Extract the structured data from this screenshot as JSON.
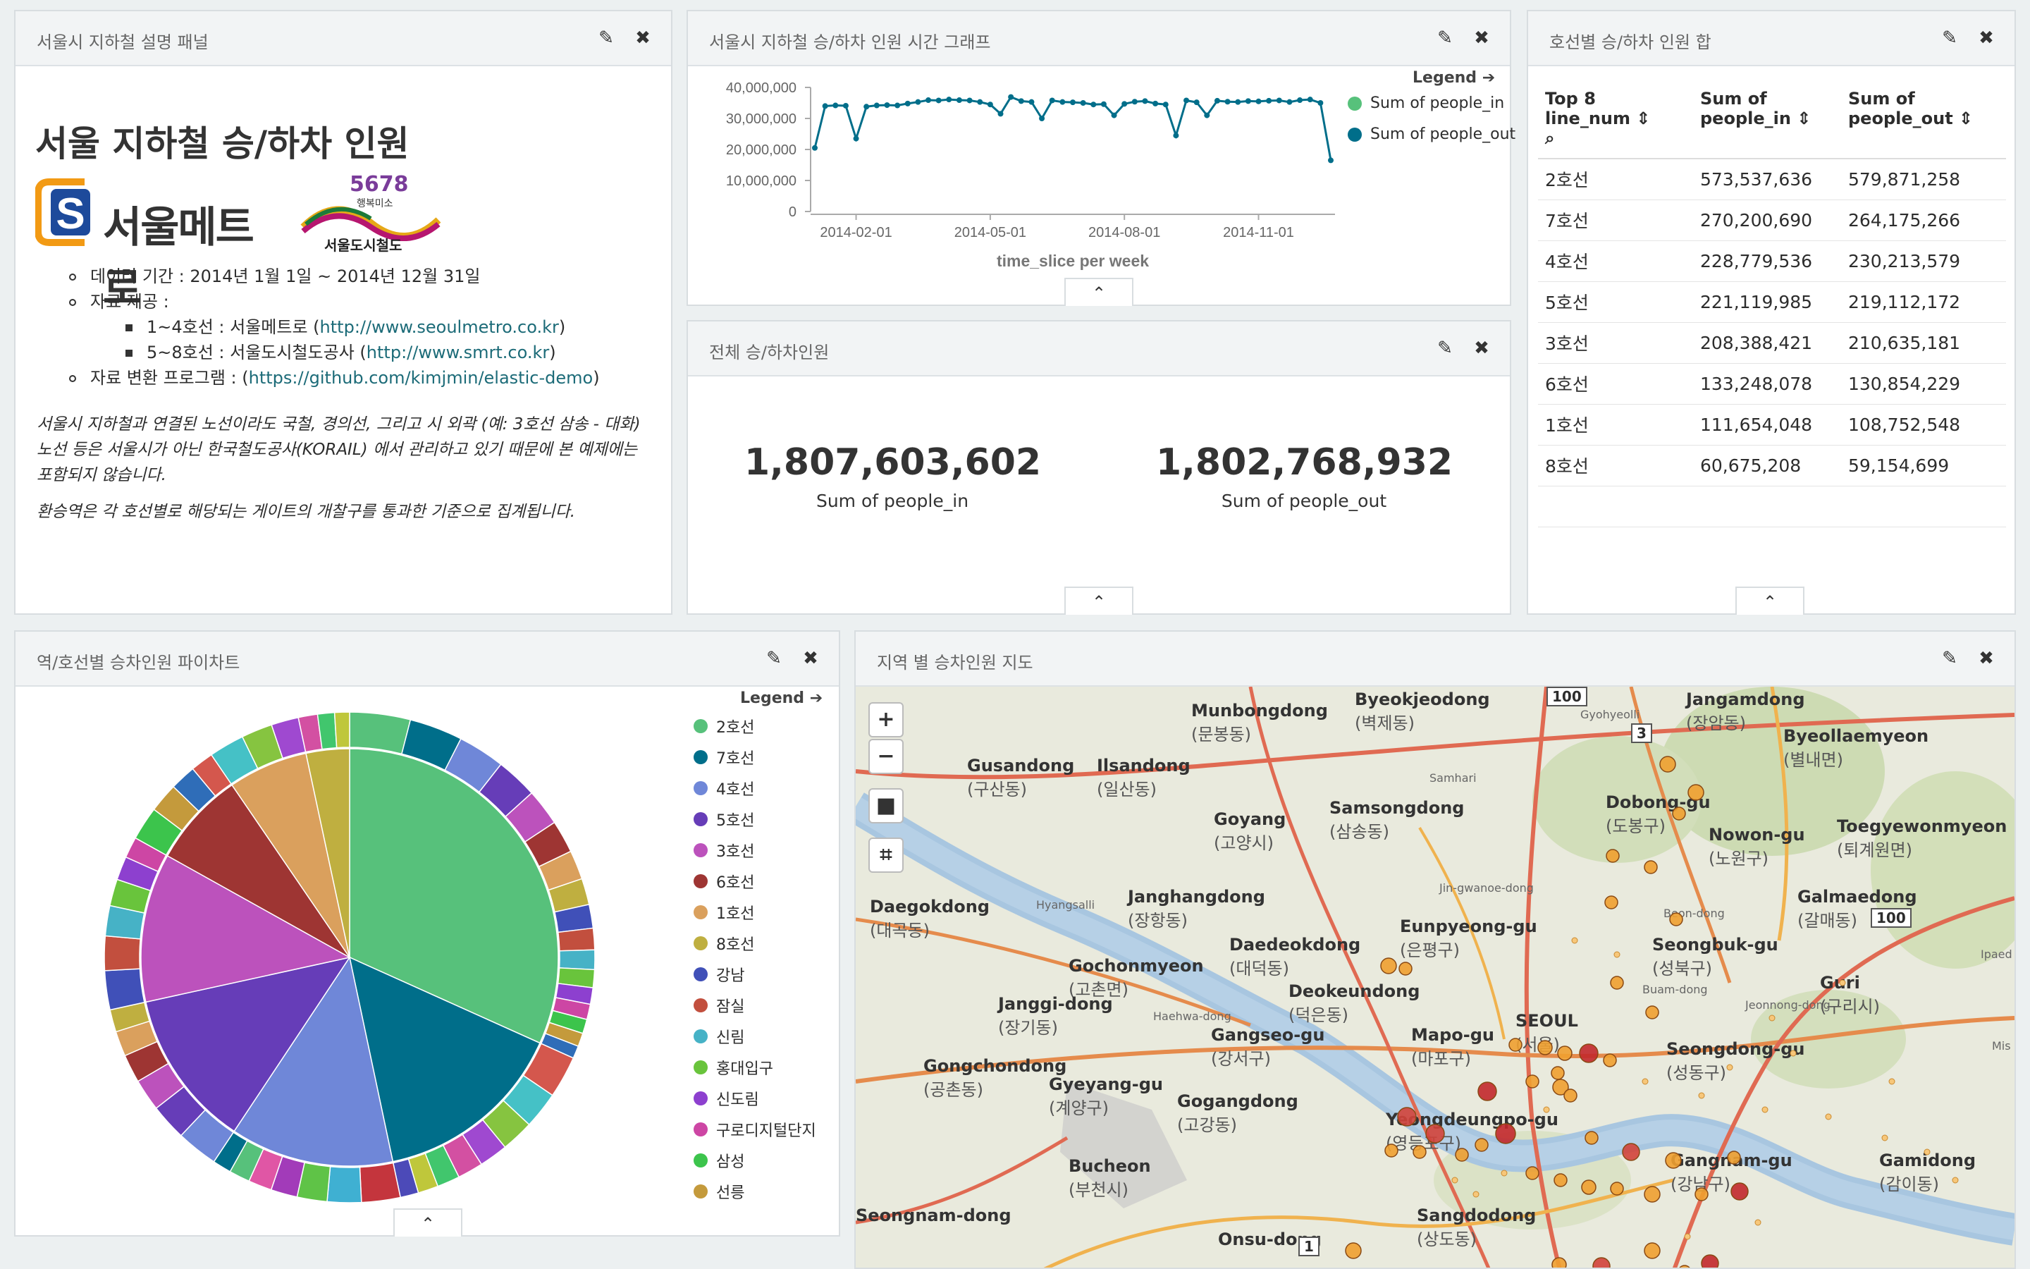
{
  "panel_desc": {
    "title": "서울시 지하철 설명 패널",
    "heading": "서울 지하철 승/하차 인원",
    "logo_metro": "서울메트로",
    "logo_smrt_num": "5678",
    "logo_smrt_sub": "행복미소",
    "logo_smrt": "서울도시철도",
    "item_period": "데이터 기간 : 2014년 1월 1일 ~ 2014년 12월 31일",
    "item_source": "자료 제공 :",
    "sub1_text": "1~4호선 : 서울메트로 (",
    "sub1_link": "http://www.seoulmetro.co.kr",
    "sub2_text": "5~8호선 : 서울도시철도공사 (",
    "sub2_link": "http://www.smrt.co.kr",
    "item_prog_text": "자료 변환 프로그램 : (",
    "item_prog_link": "https://github.com/kimjmin/elastic-demo",
    "close_paren": ")",
    "note1": "서울시 지하철과 연결된 노선이라도 국철, 경의선, 그리고 시 외곽 (예: 3호선 삼송 - 대화) 노선 등은 서울시가 아닌 한국철도공사(KORAIL) 에서 관리하고 있기 때문에 본 예제에는 포함되지 않습니다.",
    "note2": "환승역은 각 호선별로 해당되는 게이트의 개찰구를 통과한 기준으로 집계됩니다."
  },
  "panel_line": {
    "title": "서울시 지하철 승/하차 인원 시간 그래프",
    "legend_title": "Legend",
    "legend": [
      {
        "label": "Sum of people_in",
        "color": "#57c17b"
      },
      {
        "label": "Sum of people_out",
        "color": "#006e8a"
      }
    ],
    "yticks": [
      "40,000,000",
      "30,000,000",
      "20,000,000",
      "10,000,000",
      "0"
    ],
    "xticks": [
      "2014-02-01",
      "2014-05-01",
      "2014-08-01",
      "2014-11-01"
    ],
    "xlabel": "time_slice per week"
  },
  "chart_data": {
    "type": "line",
    "x_unit": "week index 2014",
    "ylim": [
      0,
      40000000
    ],
    "series": [
      {
        "name": "Sum of people_in",
        "values": [
          20500000,
          34000000,
          34200000,
          34100000,
          23500000,
          33800000,
          34200000,
          34300000,
          34200000,
          34800000,
          35300000,
          35900000,
          35800000,
          36100000,
          35900000,
          35800000,
          35300000,
          34500000,
          31500000,
          36900000,
          35600000,
          35300000,
          30000000,
          35800000,
          35300000,
          35200000,
          35000000,
          34500000,
          34600000,
          31000000,
          34700000,
          35400000,
          35600000,
          34800000,
          34500000,
          24500000,
          35800000,
          35200000,
          31000000,
          35700000,
          35400000,
          35300000,
          35600000,
          35500000,
          35700000,
          35800000,
          35300000,
          35900000,
          36100000,
          35000000,
          16500000
        ]
      }
    ]
  },
  "panel_metric": {
    "title": "전체 승/하차인원",
    "in_value": "1,807,603,602",
    "in_label": "Sum of people_in",
    "out_value": "1,802,768,932",
    "out_label": "Sum of people_out"
  },
  "panel_table": {
    "title": "호선별 승/하차 인원 합",
    "col1": "Top 8 line_num",
    "col2": "Sum of people_in",
    "col3": "Sum of people_out",
    "rows": [
      [
        "2호선",
        "573,537,636",
        "579,871,258"
      ],
      [
        "7호선",
        "270,200,690",
        "264,175,266"
      ],
      [
        "4호선",
        "228,779,536",
        "230,213,579"
      ],
      [
        "5호선",
        "221,119,985",
        "219,112,172"
      ],
      [
        "3호선",
        "208,388,421",
        "210,635,181"
      ],
      [
        "6호선",
        "133,248,078",
        "130,854,229"
      ],
      [
        "1호선",
        "111,654,048",
        "108,752,548"
      ],
      [
        "8호선",
        "60,675,208",
        "59,154,699"
      ]
    ]
  },
  "panel_pie": {
    "title": "역/호선별 승차인원 파이차트",
    "legend_title": "Legend",
    "legend": [
      {
        "label": "2호선",
        "color": "#57c17b"
      },
      {
        "label": "7호선",
        "color": "#006e8a"
      },
      {
        "label": "4호선",
        "color": "#6f87d8"
      },
      {
        "label": "5호선",
        "color": "#663db8"
      },
      {
        "label": "3호선",
        "color": "#bc52bc"
      },
      {
        "label": "6호선",
        "color": "#9e3533"
      },
      {
        "label": "1호선",
        "color": "#daa05d"
      },
      {
        "label": "8호선",
        "color": "#bfaf40"
      },
      {
        "label": "강남",
        "color": "#4050b8"
      },
      {
        "label": "잠실",
        "color": "#c24f3e"
      },
      {
        "label": "신림",
        "color": "#46b2c6"
      },
      {
        "label": "홍대입구",
        "color": "#69c43c"
      },
      {
        "label": "신도림",
        "color": "#8d40cf"
      },
      {
        "label": "구로디지털단지",
        "color": "#cd46a4"
      },
      {
        "label": "삼성",
        "color": "#3cc44c"
      },
      {
        "label": "선릉",
        "color": "#c49a3c"
      }
    ]
  },
  "pie_data": {
    "type": "pie",
    "inner_labels": [
      "2호선",
      "7호선",
      "4호선",
      "5호선",
      "3호선",
      "6호선",
      "1호선",
      "8호선"
    ],
    "inner_values": [
      573537636,
      270200690,
      228779536,
      221119985,
      208388421,
      133248078,
      111654048,
      60675208
    ]
  },
  "panel_map": {
    "title": "지역 별 승차인원 지도",
    "zoom_in": "+",
    "zoom_out": "−",
    "places": [
      {
        "en": "Byeokjeodong",
        "ko": "(벽제동)"
      },
      {
        "en": "Jangamdong",
        "ko": "(장암동)"
      },
      {
        "en": "Munbongdong",
        "ko": "(문봉동)"
      },
      {
        "en": "Gusandong",
        "ko": "(구산동)"
      },
      {
        "en": "Ilsandong",
        "ko": "(일산동)"
      },
      {
        "en": "Byeollaemyeon",
        "ko": "(별내면)"
      },
      {
        "en": "Goyang",
        "ko": "(고양시)"
      },
      {
        "en": "Samsongdong",
        "ko": "(삼송동)"
      },
      {
        "en": "Dobong-gu",
        "ko": "(도봉구)"
      },
      {
        "en": "Nowon-gu",
        "ko": "(노원구)"
      },
      {
        "en": "Toegyewonmyeon",
        "ko": "(퇴계원면)"
      },
      {
        "en": "Janghangdong",
        "ko": "(장항동)"
      },
      {
        "en": "Daegokdong",
        "ko": "(대곡동)"
      },
      {
        "en": "Galmaedong",
        "ko": "(갈매동)"
      },
      {
        "en": "Eunpyeong-gu",
        "ko": "(은평구)"
      },
      {
        "en": "Daedeokdong",
        "ko": "(대덕동)"
      },
      {
        "en": "Gochonmyeon",
        "ko": "(고촌면)"
      },
      {
        "en": "Seongbuk-gu",
        "ko": "(성북구)"
      },
      {
        "en": "Guri",
        "ko": "(구리시)"
      },
      {
        "en": "Deokeundong",
        "ko": "(덕은동)"
      },
      {
        "en": "Janggi-dong",
        "ko": "(장기동)"
      },
      {
        "en": "SEOUL",
        "ko": "(서울)"
      },
      {
        "en": "Gangseo-gu",
        "ko": "(강서구)"
      },
      {
        "en": "Mapo-gu",
        "ko": "(마포구)"
      },
      {
        "en": "Seongdong-gu",
        "ko": "(성동구)"
      },
      {
        "en": "Gongchondong",
        "ko": "(공촌동)"
      },
      {
        "en": "Gyeyang-gu",
        "ko": "(계양구)"
      },
      {
        "en": "Gogangdong",
        "ko": "(고강동)"
      },
      {
        "en": "Yeongdeungpo-gu",
        "ko": "(영등포구)"
      },
      {
        "en": "Bucheon",
        "ko": "(부천시)"
      },
      {
        "en": "Gangnam-gu",
        "ko": "(강남구)"
      },
      {
        "en": "Gamidong",
        "ko": "(감이동)"
      },
      {
        "en": "Sangdodong",
        "ko": "(상도동)"
      },
      {
        "en": "Onsu-dong",
        "ko": ""
      },
      {
        "en": "Seongnam-dong",
        "ko": ""
      }
    ],
    "road_100a": "100",
    "road_3": "3",
    "road_100b": "100",
    "road_1": "1",
    "mini": [
      "Gyohyeolli",
      "Samhari",
      "Hyangsalli",
      "Jin-gwanoe-dong",
      "Buam-dong",
      "Jeonnong-dong",
      "Haehwa-dong",
      "Beon-dong",
      "Ipaed",
      "Mis"
    ]
  }
}
